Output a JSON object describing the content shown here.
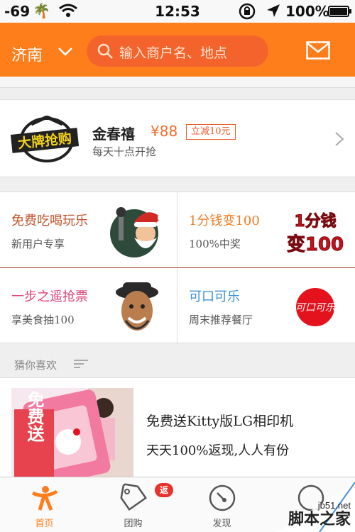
{
  "status_bar": {
    "signal": "-69",
    "time": "12:53",
    "battery": "100%",
    "icons": [
      "palm-tree-icon",
      "wifi-icon",
      "rotation-lock-icon",
      "location-arrow-icon",
      "battery-icon"
    ]
  },
  "header": {
    "city": "济南",
    "search_placeholder": "输入商户名、地点",
    "icons": [
      "chevron-down-icon",
      "search-icon",
      "mail-icon"
    ],
    "colors": {
      "header": "#ff7e1c",
      "search": "#f5632c"
    }
  },
  "brand_deal": {
    "logo_text": "大牌抢购",
    "title": "金春禧",
    "price": "¥88",
    "tag": "立减10元",
    "subtitle": "每天十点开抢"
  },
  "grid": [
    {
      "title": "免费吃喝玩乐",
      "subtitle": "新用户专享",
      "title_color": "#c0532b",
      "image": "santa-icon"
    },
    {
      "title": "1分钱变100",
      "subtitle": "100%中奖",
      "title_color": "#f07d23",
      "image_text_top": "1分钱",
      "image_text_bottom": "变100"
    },
    {
      "title": "一步之遥抢票",
      "subtitle": "享美食抽100",
      "title_color": "#e0427a",
      "image": "actor-portrait-icon"
    },
    {
      "title": "可口可乐",
      "subtitle": "周末推荐餐厅",
      "title_color": "#3a8fd8",
      "image_text": "可口可乐"
    }
  ],
  "section": {
    "title": "猜你喜欢"
  },
  "promo": {
    "image_text": "免费送",
    "title": "免费送Kitty版LG相印机",
    "subtitle": "天天100%返现,人人有份"
  },
  "tabs": [
    {
      "label": "首页",
      "icon": "home-person-icon",
      "active": true
    },
    {
      "label": "团购",
      "icon": "tag-icon",
      "badge": "返"
    },
    {
      "label": "发现",
      "icon": "compass-icon"
    },
    {
      "label": "",
      "icon": "more-icon"
    }
  ],
  "watermark": {
    "site": "jb51.net",
    "name": "脚本之家"
  }
}
